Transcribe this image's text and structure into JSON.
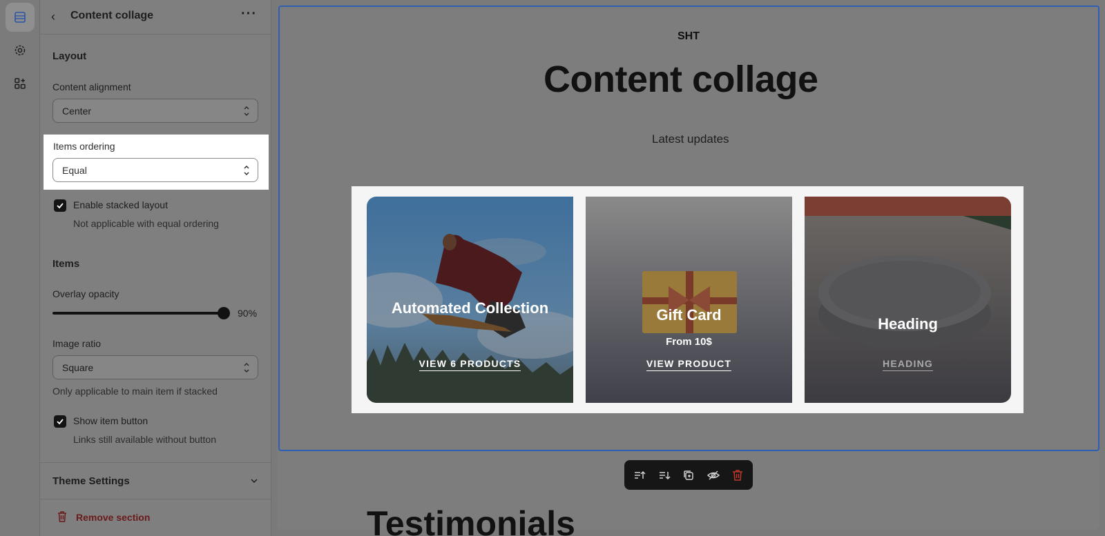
{
  "panel": {
    "title": "Content collage",
    "layout_heading": "Layout",
    "content_alignment": {
      "label": "Content alignment",
      "value": "Center"
    },
    "items_ordering": {
      "label": "Items ordering",
      "value": "Equal"
    },
    "stacked_layout": {
      "label": "Enable stacked layout",
      "help": "Not applicable with equal ordering",
      "checked": true
    },
    "items_heading": "Items",
    "overlay_opacity": {
      "label": "Overlay opacity",
      "value": "90%",
      "level": 0.9
    },
    "image_ratio": {
      "label": "Image ratio",
      "value": "Square",
      "help": "Only applicable to main item if stacked"
    },
    "show_item_button": {
      "label": "Show item button",
      "help": "Links still available without button",
      "checked": true
    },
    "theme_settings": "Theme Settings",
    "remove_section": "Remove section"
  },
  "rail": {
    "icons": [
      "sections-icon",
      "gear-icon",
      "apps-icon"
    ]
  },
  "preview": {
    "subheading": "SHT",
    "heading": "Content collage",
    "caption": "Latest updates",
    "cards": [
      {
        "title": "Automated Collection",
        "subtitle": "",
        "link": "VIEW 6 PRODUCTS"
      },
      {
        "title": "Gift Card",
        "subtitle": "From 10$",
        "link": "VIEW PRODUCT"
      },
      {
        "title": "Heading",
        "subtitle": "",
        "link": "HEADING"
      }
    ],
    "next_section_heading": "Testimonials"
  },
  "toolbar": {
    "icons": [
      "move-up-icon",
      "move-down-icon",
      "duplicate-icon",
      "hide-icon",
      "delete-icon"
    ]
  },
  "colors": {
    "selection_outline": "#2f5fb3",
    "remove_text": "#6a1a1a",
    "toolbar_bg": "#161616"
  }
}
